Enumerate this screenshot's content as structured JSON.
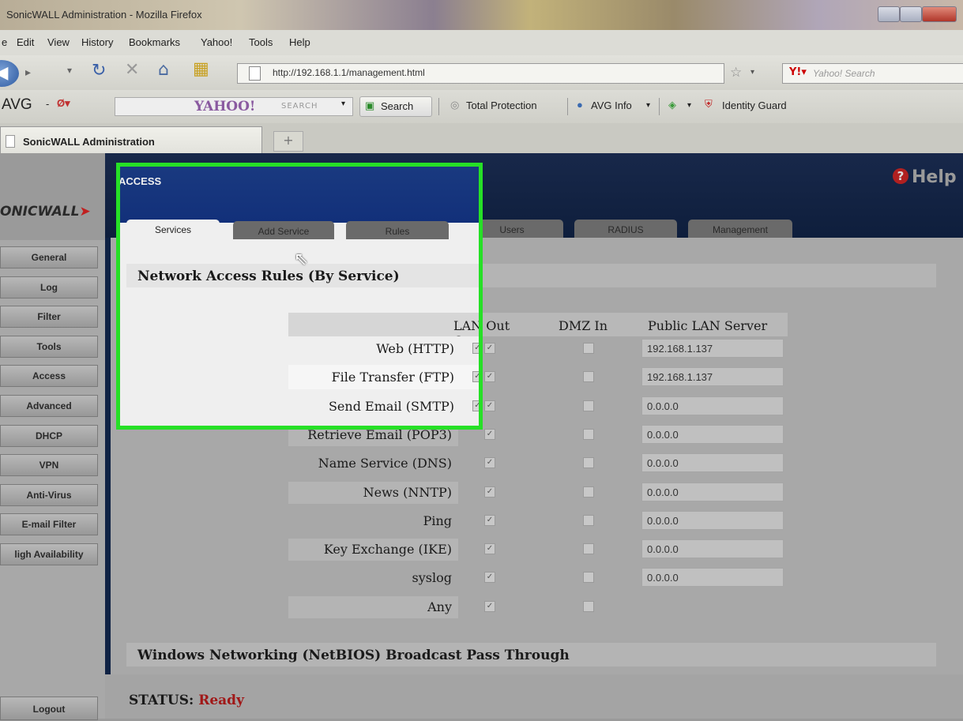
{
  "window": {
    "title": "SonicWALL Administration - Mozilla Firefox"
  },
  "menubar": {
    "items": [
      "e",
      "Edit",
      "View",
      "History",
      "Bookmarks",
      "Yahoo!",
      "Tools",
      "Help"
    ]
  },
  "navbar": {
    "url": "http://192.168.1.1/management.html",
    "search_placeholder": "Yahoo! Search"
  },
  "toolbar": {
    "avg_label": "AVG",
    "yahoo_logo": "YAHOO!",
    "yahoo_search_hint": "SEARCH",
    "search_button": "Search",
    "total_protection": "Total Protection",
    "avg_info": "AVG Info",
    "identity_guard": "Identity Guard"
  },
  "browser_tab": {
    "title": "SonicWALL Administration",
    "new_tab": "+"
  },
  "app": {
    "logo": "ONICWALL",
    "section": "ACCESS",
    "help": "Help",
    "tabs": [
      "Services",
      "Add Service",
      "Rules",
      "Users",
      "RADIUS",
      "Management"
    ],
    "active_tab": "Services",
    "nav": [
      "General",
      "Log",
      "Filter",
      "Tools",
      "Access",
      "Advanced",
      "DHCP",
      "VPN",
      "Anti-Virus",
      "E-mail Filter",
      "ligh Availability"
    ],
    "logout": "Logout"
  },
  "rules": {
    "heading": "Network Access Rules (By Service)",
    "columns": {
      "lan_out": "LAN Out",
      "dmz_in": "DMZ In",
      "public_server": "Public LAN Server"
    },
    "rows": [
      {
        "service": "Web (HTTP)",
        "lan_out": true,
        "dmz_in": false,
        "server": "192.168.1.137"
      },
      {
        "service": "File Transfer (FTP)",
        "lan_out": true,
        "dmz_in": false,
        "server": "192.168.1.137"
      },
      {
        "service": "Send Email (SMTP)",
        "lan_out": true,
        "dmz_in": false,
        "server": "0.0.0.0"
      },
      {
        "service": "Retrieve Email (POP3)",
        "lan_out": true,
        "dmz_in": false,
        "server": "0.0.0.0"
      },
      {
        "service": "Name Service (DNS)",
        "lan_out": true,
        "dmz_in": false,
        "server": "0.0.0.0"
      },
      {
        "service": "News (NNTP)",
        "lan_out": true,
        "dmz_in": false,
        "server": "0.0.0.0"
      },
      {
        "service": "Ping",
        "lan_out": true,
        "dmz_in": false,
        "server": "0.0.0.0"
      },
      {
        "service": "Key Exchange (IKE)",
        "lan_out": true,
        "dmz_in": false,
        "server": "0.0.0.0"
      },
      {
        "service": "syslog",
        "lan_out": true,
        "dmz_in": false,
        "server": "0.0.0.0"
      },
      {
        "service": "Any",
        "lan_out": true,
        "dmz_in": false,
        "server": null
      }
    ]
  },
  "netbios": {
    "heading": "Windows Networking (NetBIOS) Broadcast Pass Through"
  },
  "status": {
    "label": "STATUS:",
    "value": "Ready"
  },
  "colors": {
    "highlight": "#26e026",
    "banner": "#0e1e3c",
    "ready": "#a01818"
  }
}
